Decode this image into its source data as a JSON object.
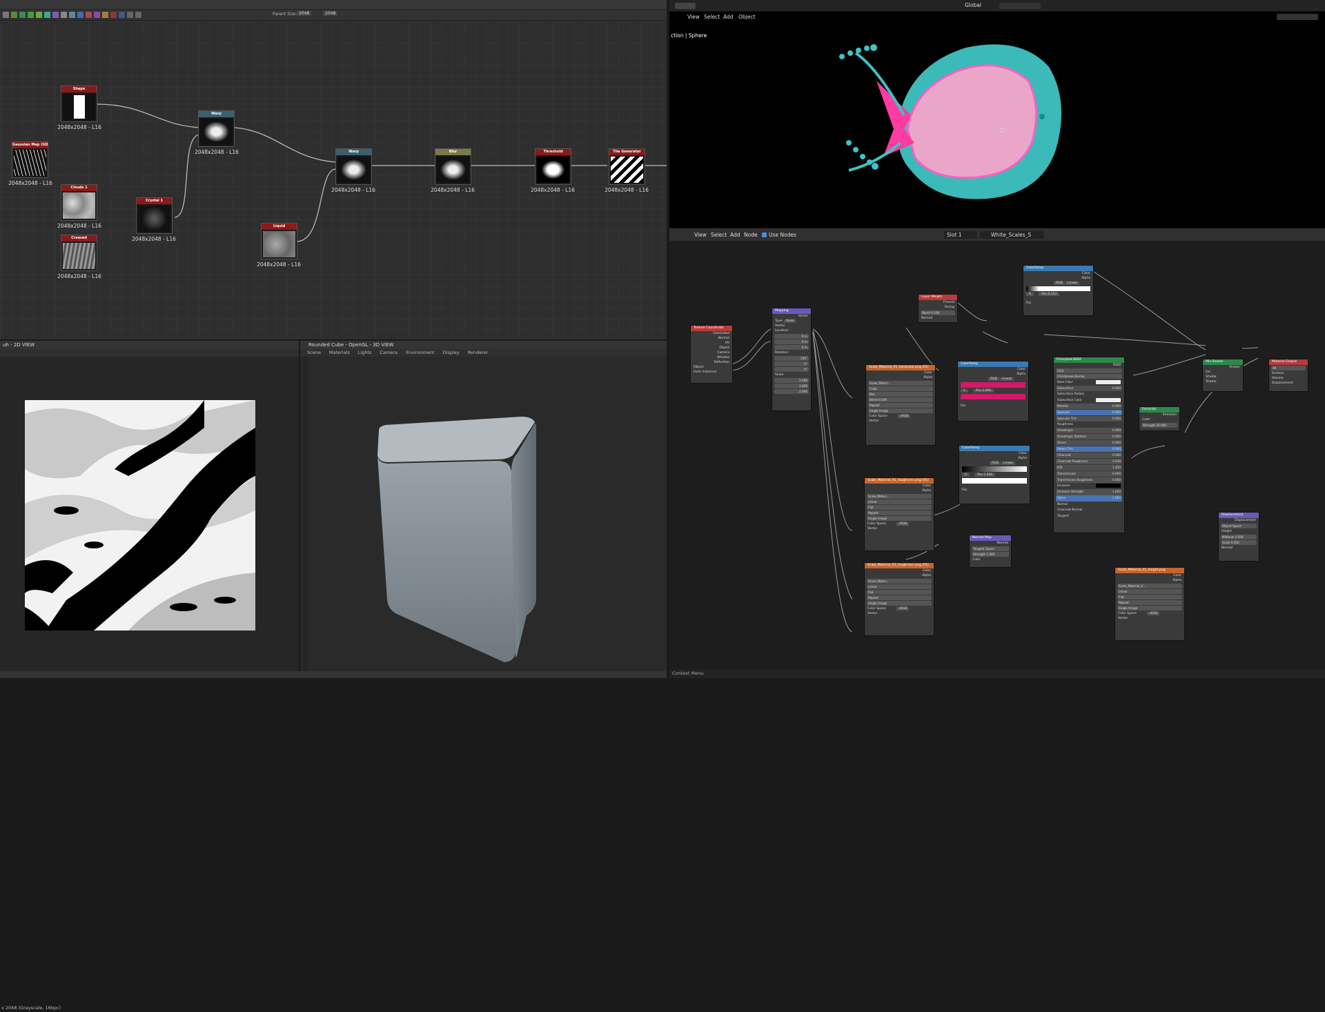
{
  "sd": {
    "toolbar": {
      "parent_size_label": "Parent Size:",
      "width_value": "2048",
      "height_value": "2048"
    },
    "nodes": [
      {
        "id": "shape",
        "title": "Shape",
        "header_color": "#8a1a1a",
        "caption": "2048x2048 - L16"
      },
      {
        "id": "gaussian",
        "title": "Gaussian Map (GD)",
        "header_color": "#8a1a1a",
        "caption": "2048x2048 - L16"
      },
      {
        "id": "clouds",
        "title": "Clouds 1",
        "header_color": "#8a1a1a",
        "caption": "2048x2048 - L16"
      },
      {
        "id": "crystal",
        "title": "Crystal 1",
        "header_color": "#8a1a1a",
        "caption": "2048x2048 - L16"
      },
      {
        "id": "creased",
        "title": "Creased",
        "header_color": "#8a1a1a",
        "caption": "2048x2048 - L16"
      },
      {
        "id": "warp",
        "title": "Warp",
        "header_color": "#3c5f6e",
        "caption": "2048x2048 - L16"
      },
      {
        "id": "liquid",
        "title": "Liquid",
        "header_color": "#8a1a1a",
        "caption": "2048x2048 - L16"
      },
      {
        "id": "warp2",
        "title": "Warp",
        "header_color": "#3c5f6e",
        "caption": "2048x2048 - L16"
      },
      {
        "id": "blur",
        "title": "Blur",
        "header_color": "#7a7a4a",
        "caption": "2048x2048 - L16"
      },
      {
        "id": "threshold",
        "title": "Threshold",
        "header_color": "#8a1a1a",
        "caption": "2048x2048 - L16"
      },
      {
        "id": "tile",
        "title": "Tile Generator",
        "header_color": "#8a1a1a",
        "caption": "2048x2048 - L16"
      }
    ],
    "view2d": {
      "title": "uh - 2D VIEW",
      "status": "x 2048 (Grayscale, 16bpc)"
    },
    "view3d": {
      "title": "Rounded Cube - OpenGL - 3D VIEW",
      "menu": [
        "Scene",
        "Materials",
        "Lights",
        "Camera",
        "Environment",
        "Display",
        "Renderer"
      ]
    }
  },
  "blender": {
    "topbar": {
      "orientation": "Global"
    },
    "viewport": {
      "menu": [
        "View",
        "Select",
        "Add",
        "Object"
      ],
      "overlay_text": "ction | Sphere"
    },
    "node_editor": {
      "menu": [
        "View",
        "Select",
        "Add",
        "Node"
      ],
      "use_nodes_label": "Use Nodes",
      "slot": "Slot 1",
      "material": "White_Scales_S"
    },
    "nodes": {
      "tex_coord": {
        "title": "Texture Coordinate",
        "outputs": [
          "Generated",
          "Normal",
          "UV",
          "Object",
          "Camera",
          "Window",
          "Reflection"
        ],
        "object_label": "Object",
        "from_instancer": "From Instancer"
      },
      "mapping": {
        "title": "Mapping",
        "out": "Vector",
        "type_label": "Type:",
        "type": "Point",
        "vector": "Vector",
        "location": "Location:",
        "rotation": "Rotation:",
        "scale": "Scale:",
        "loc": [
          "0 m",
          "0 m",
          "0 m"
        ],
        "rot": [
          "150°",
          "0°",
          "0°"
        ],
        "scl": [
          "2.000",
          "2.000",
          "2.000"
        ]
      },
      "layer_weight": {
        "title": "Layer Weight",
        "outputs": [
          "Fresnel",
          "Facing"
        ],
        "blend": "Blend  0.100",
        "normal": "Normal"
      },
      "color_ramp_top": {
        "title": "ColorRamp",
        "outputs": [
          "Color",
          "Alpha"
        ],
        "mode": "RGB",
        "interp": "Linear",
        "pos_index": "0",
        "pos": "Pos  0.153",
        "fac": "Fac"
      },
      "tex_base": {
        "title": "Scale_Material_01_basecolor.png (01)",
        "outputs": [
          "Color",
          "Alpha"
        ],
        "image": "Scale_Materi...",
        "fields": [
          "Cubic",
          "Box",
          "Blend  0.000",
          "Repeat",
          "Single Image"
        ],
        "color_space_label": "Color Space",
        "color_space": "sRGB",
        "vector": "Vector"
      },
      "color_ramp_mid": {
        "title": "ColorRamp",
        "outputs": [
          "Color",
          "Alpha"
        ],
        "mode": "RGB",
        "interp": "Linear",
        "pos_index": "1",
        "pos": "Pos  1.000",
        "fac": "Fac"
      },
      "principled": {
        "title": "Principled BSDF",
        "out": "BSDF",
        "dist": "GGX",
        "sss": "Christensen-Burley",
        "rows": [
          [
            "Base Color",
            ""
          ],
          [
            "Subsurface",
            "0.000"
          ],
          [
            "Subsurface Radius",
            ""
          ],
          [
            "Subsurface Color",
            ""
          ],
          [
            "Metallic",
            "0.000"
          ],
          [
            "Specular",
            "0.500"
          ],
          [
            "Specular Tint",
            "0.000"
          ],
          [
            "Roughness",
            ""
          ],
          [
            "Anisotropic",
            "0.000"
          ],
          [
            "Anisotropic Rotation",
            "0.000"
          ],
          [
            "Sheen",
            "0.000"
          ],
          [
            "Sheen Tint",
            "0.500"
          ],
          [
            "Clearcoat",
            "0.000"
          ],
          [
            "Clearcoat Roughness",
            "0.030"
          ],
          [
            "IOR",
            "1.450"
          ],
          [
            "Transmission",
            "0.000"
          ],
          [
            "Transmission Roughness",
            "0.000"
          ],
          [
            "Emission",
            ""
          ],
          [
            "Emission Strength",
            "1.000"
          ],
          [
            "Alpha",
            "1.000"
          ],
          [
            "Normal",
            ""
          ],
          [
            "Clearcoat Normal",
            ""
          ],
          [
            "Tangent",
            ""
          ]
        ]
      },
      "color_ramp_low": {
        "title": "ColorRamp",
        "outputs": [
          "Color",
          "Alpha"
        ],
        "mode": "RGB",
        "interp": "Linear",
        "pos_index": "0",
        "pos": "Pos  1.000",
        "fac": "Fac"
      },
      "emission": {
        "title": "Emission",
        "out": "Emission",
        "color": "Color",
        "strength": "Strength  20.000"
      },
      "mix_shader": {
        "title": "Mix Shader",
        "out": "Shader",
        "inputs": [
          "Fac",
          "Shader",
          "Shader"
        ]
      },
      "material_output": {
        "title": "Material Output",
        "target": "All",
        "inputs": [
          "Surface",
          "Volume",
          "Displacement"
        ]
      },
      "tex_rough": {
        "title": "Scale_Material_01_roughness.png (01)",
        "outputs": [
          "Color",
          "Alpha"
        ],
        "image": "Scale_Materi...",
        "fields": [
          "Linear",
          "Flat",
          "Repeat",
          "Single Image"
        ],
        "color_space_label": "Color Space",
        "color_space": "sRGB",
        "vector": "Vector"
      },
      "normal_map": {
        "title": "Normal Map",
        "out": "Normal",
        "space": "Tangent Space",
        "strength": "Strength  1.000",
        "color": "Color"
      },
      "tex_rough2": {
        "title": "Scale_Material_01_roughness.png (01)",
        "outputs": [
          "Color",
          "Alpha"
        ],
        "image": "Scale_Materi...",
        "fields": [
          "Linear",
          "Flat",
          "Repeat",
          "Single Image"
        ],
        "color_space_label": "Color Space",
        "color_space": "sRGB",
        "vector": "Vector"
      },
      "tex_height": {
        "title": "Scale_Material_01_height.png",
        "outputs": [
          "Color",
          "Alpha"
        ],
        "image": "Scale_Material_0...",
        "fields": [
          "Linear",
          "Flat",
          "Repeat",
          "Single Image"
        ],
        "color_space_label": "Color Space",
        "color_space": "sRGB",
        "vector": "Vector"
      },
      "displacement": {
        "title": "Displacement",
        "out": "Displacement",
        "space": "Object Space",
        "height": "Height",
        "midlevel": "Midlevel  0.500",
        "scale": "Scale  0.050",
        "normal": "Normal"
      }
    },
    "status": "Context Menu",
    "colors": {
      "texture_header": "#c8642a",
      "converter_header": "#3a7ab0",
      "shader_header": "#2a8a4a",
      "input_header": "#b83a3a",
      "vector_header": "#6a5ab8",
      "output_header": "#b83a3a"
    }
  }
}
